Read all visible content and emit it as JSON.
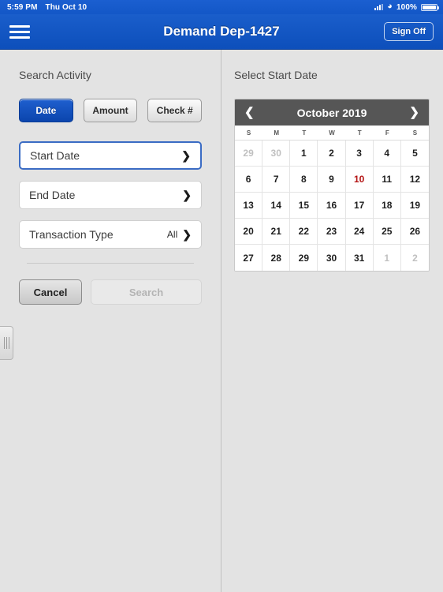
{
  "status_bar": {
    "time": "5:59 PM",
    "date": "Thu Oct 10",
    "battery_percent": "100%",
    "signal_icon": "cellular-signal-icon",
    "wifi_icon": "wifi-icon",
    "battery_icon": "battery-icon"
  },
  "nav": {
    "menu_icon": "hamburger-menu-icon",
    "title": "Demand Dep-1427",
    "sign_off_label": "Sign Off"
  },
  "left_panel": {
    "title": "Search Activity",
    "segments": [
      {
        "label": "Date",
        "active": true
      },
      {
        "label": "Amount",
        "active": false
      },
      {
        "label": "Check #",
        "active": false
      }
    ],
    "fields": [
      {
        "label": "Start Date",
        "value": "",
        "focused": true,
        "chevron": "chevron-right-icon"
      },
      {
        "label": "End Date",
        "value": "",
        "focused": false,
        "chevron": "chevron-right-icon"
      },
      {
        "label": "Transaction Type",
        "value": "All",
        "focused": false,
        "chevron": "chevron-right-icon"
      }
    ],
    "cancel_label": "Cancel",
    "search_label": "Search",
    "search_disabled": true,
    "drag_handle_icon": "drag-handle-icon"
  },
  "right_panel": {
    "title": "Select Start Date",
    "calendar": {
      "month_label": "October 2019",
      "prev_icon": "chevron-left-icon",
      "next_icon": "chevron-right-icon",
      "weekdays": [
        "S",
        "M",
        "T",
        "W",
        "T",
        "F",
        "S"
      ],
      "days": [
        {
          "n": "29",
          "state": "muted"
        },
        {
          "n": "30",
          "state": "muted"
        },
        {
          "n": "1",
          "state": ""
        },
        {
          "n": "2",
          "state": ""
        },
        {
          "n": "3",
          "state": ""
        },
        {
          "n": "4",
          "state": ""
        },
        {
          "n": "5",
          "state": ""
        },
        {
          "n": "6",
          "state": ""
        },
        {
          "n": "7",
          "state": ""
        },
        {
          "n": "8",
          "state": ""
        },
        {
          "n": "9",
          "state": ""
        },
        {
          "n": "10",
          "state": "today"
        },
        {
          "n": "11",
          "state": ""
        },
        {
          "n": "12",
          "state": ""
        },
        {
          "n": "13",
          "state": ""
        },
        {
          "n": "14",
          "state": ""
        },
        {
          "n": "15",
          "state": ""
        },
        {
          "n": "16",
          "state": ""
        },
        {
          "n": "17",
          "state": ""
        },
        {
          "n": "18",
          "state": ""
        },
        {
          "n": "19",
          "state": ""
        },
        {
          "n": "20",
          "state": ""
        },
        {
          "n": "21",
          "state": ""
        },
        {
          "n": "22",
          "state": ""
        },
        {
          "n": "23",
          "state": ""
        },
        {
          "n": "24",
          "state": ""
        },
        {
          "n": "25",
          "state": ""
        },
        {
          "n": "26",
          "state": ""
        },
        {
          "n": "27",
          "state": ""
        },
        {
          "n": "28",
          "state": ""
        },
        {
          "n": "29",
          "state": ""
        },
        {
          "n": "30",
          "state": ""
        },
        {
          "n": "31",
          "state": ""
        },
        {
          "n": "1",
          "state": "muted"
        },
        {
          "n": "2",
          "state": "muted"
        }
      ]
    }
  },
  "colors": {
    "brand_blue": "#1357c7",
    "accent_blue": "#0b45ad",
    "calendar_header": "#565656",
    "today_red": "#b41414",
    "page_bg": "#e3e3e3"
  }
}
